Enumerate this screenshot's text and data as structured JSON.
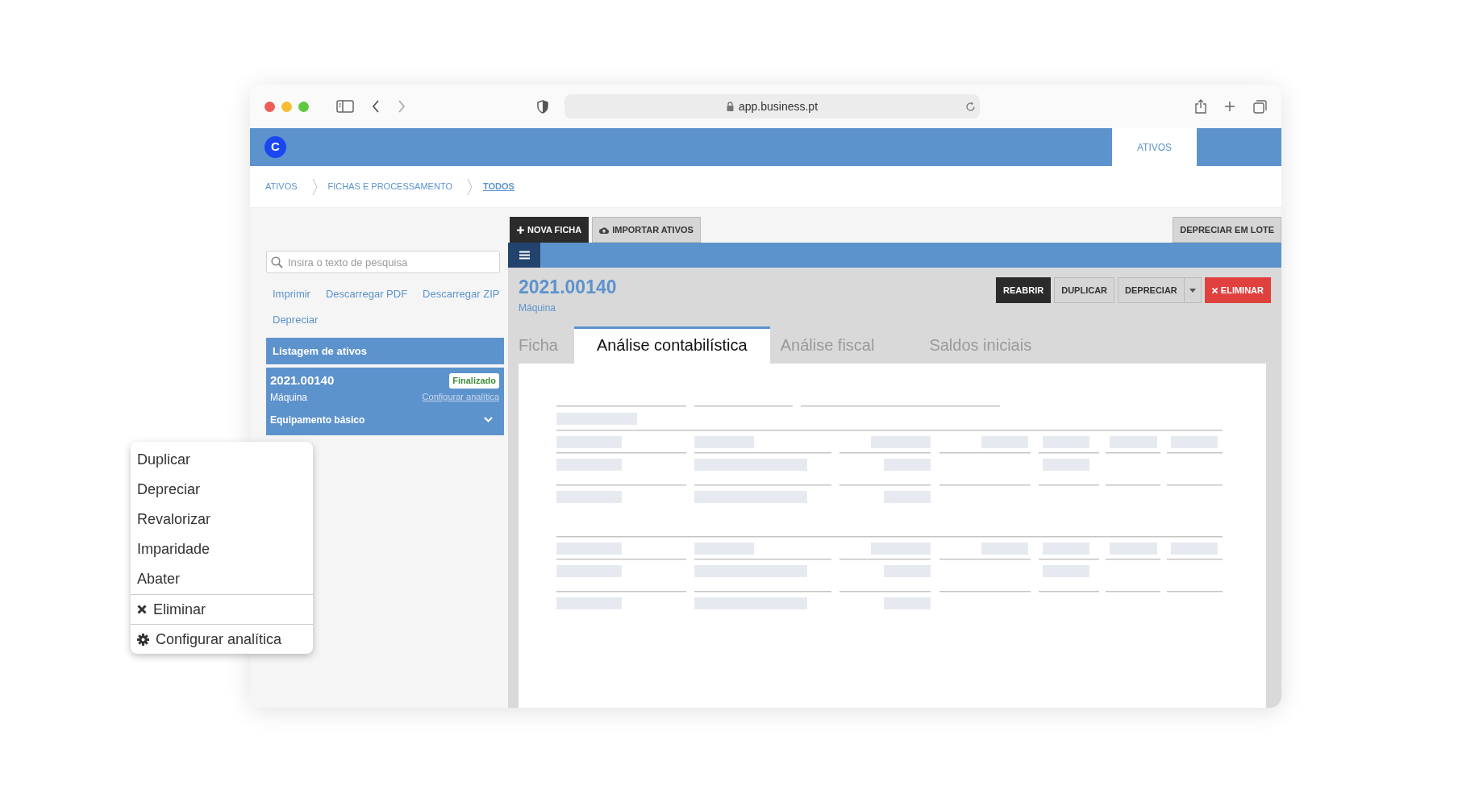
{
  "browser": {
    "url": "app.business.pt"
  },
  "app_bar": {
    "logo": "C",
    "tabs": [
      {
        "label": "ATIVOS",
        "selected": true
      }
    ]
  },
  "breadcrumb": [
    {
      "label": "ATIVOS",
      "current": false
    },
    {
      "label": "FICHAS E PROCESSAMENTO",
      "current": false
    },
    {
      "label": "TODOS",
      "current": true
    }
  ],
  "sidebar": {
    "search": {
      "placeholder": "Insira o texto de pesquisa"
    },
    "links": [
      "Imprimir",
      "Descarregar PDF",
      "Descarregar ZIP",
      "Depreciar"
    ],
    "list_title": "Listagem de ativos",
    "items": [
      {
        "code": "2021.00140",
        "type": "Máquina",
        "status": "Finalizado",
        "link": "Configurar analítica",
        "category": "Equipamento básico",
        "selected": true
      }
    ]
  },
  "toolbar": {
    "buttons": [
      {
        "label": "NOVA FICHA",
        "kind": "add"
      },
      {
        "label": "IMPORTAR ATIVOS",
        "kind": "import"
      }
    ],
    "right_button": "DEPRECIAR EM LOTE"
  },
  "record": {
    "title": "2021.00140",
    "subtitle": "Máquina",
    "actions": [
      {
        "label": "REABRIR",
        "kind": "dark"
      },
      {
        "label": "DUPLICAR",
        "kind": "light"
      },
      {
        "label": "DEPRECIAR",
        "kind": "split"
      },
      {
        "label": "ELIMINAR",
        "kind": "danger"
      }
    ]
  },
  "tabs": [
    {
      "label": "Ficha",
      "selected": false
    },
    {
      "label": "Análise contabilística",
      "selected": true
    },
    {
      "label": "Análise fiscal",
      "selected": false
    },
    {
      "label": "Saldos iniciais",
      "selected": false
    }
  ],
  "context_menu": [
    {
      "label": "Duplicar",
      "kind": "plain"
    },
    {
      "label": "Depreciar",
      "kind": "plain"
    },
    {
      "label": "Revalorizar",
      "kind": "plain"
    },
    {
      "label": "Imparidade",
      "kind": "plain"
    },
    {
      "label": "Abater",
      "kind": "plain"
    },
    {
      "label": "Eliminar",
      "kind": "delete"
    },
    {
      "label": "Configurar analítica",
      "kind": "settings"
    }
  ]
}
